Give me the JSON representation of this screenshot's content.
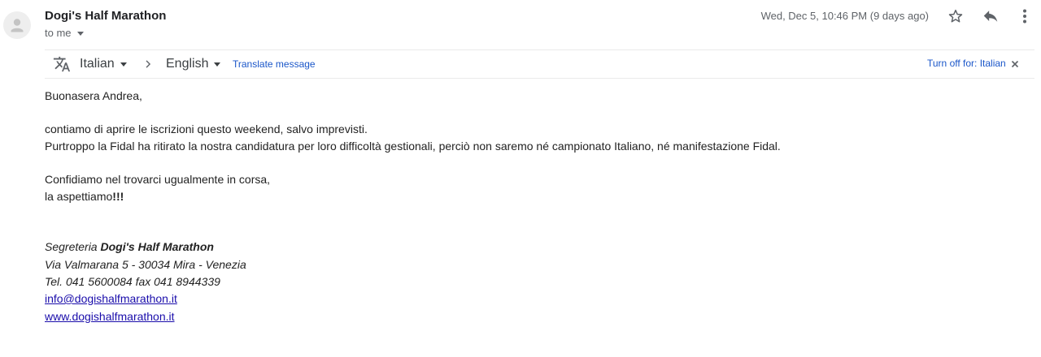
{
  "header": {
    "sender_name": "Dogi's Half Marathon",
    "recipient_label": "to me",
    "date": "Wed, Dec 5, 10:46 PM (9 days ago)",
    "icons": [
      "avatar-placeholder-icon",
      "star-icon",
      "reply-icon",
      "more-vert-icon"
    ]
  },
  "translate_bar": {
    "source_language": "Italian",
    "target_language": "English",
    "translate_link": "Translate message",
    "turn_off_link": "Turn off for: Italian",
    "icons": [
      "translate-icon",
      "chevron-right-icon",
      "close-icon"
    ]
  },
  "message": {
    "greeting": "Buonasera Andrea,",
    "paragraph1_line1": "contiamo di aprire le iscrizioni questo weekend, salvo imprevisti.",
    "paragraph1_line2": "Purtroppo la Fidal ha ritirato la nostra candidatura per loro difficoltà gestionali, perciò non saremo né campionato Italiano, né manifestazione Fidal.",
    "paragraph2_line1": "Confidiamo nel trovarci ugualmente in corsa,",
    "paragraph2_line2_prefix": "la aspettiamo",
    "paragraph2_line2_emphasis": "!!!"
  },
  "signature": {
    "line1_prefix": "Segreteria ",
    "line1_bold": "Dogi's Half Marathon",
    "address": "Via Valmarana 5 - 30034 Mira - Venezia",
    "phone": "Tel. 041 5600084 fax 041 8944339",
    "email": "info@dogishalfmarathon.it",
    "website": "www.dogishalfmarathon.it"
  },
  "colors": {
    "link_blue": "#1a56c9",
    "mail_link": "#1a0dab",
    "secondary_text": "#5f6368",
    "body_text": "#222222"
  }
}
